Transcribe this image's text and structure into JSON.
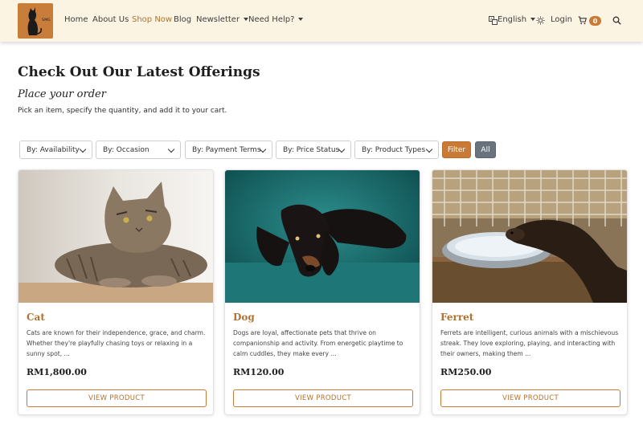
{
  "brand": {
    "logo_text": "SMG"
  },
  "nav": {
    "home": "Home",
    "about": "About Us",
    "shop": "Shop Now",
    "blog": "Blog",
    "newsletter": "Newsletter",
    "help": "Need Help?",
    "language": "English",
    "login": "Login",
    "cart_count": "0"
  },
  "icons": {
    "translate": "translate-icon",
    "theme": "sun-icon",
    "cart": "cart-icon",
    "search": "search-icon"
  },
  "colors": {
    "accent": "#c97b35",
    "nav_bg": "#fcf4e3",
    "secondary": "#6a737d"
  },
  "page": {
    "title": "Check Out Our Latest Offerings",
    "subtitle": "Place your order",
    "intro": "Pick an item, specify the quantity, and add it to your cart."
  },
  "filters": {
    "availability": "By: Availability",
    "occasion": "By: Occasion",
    "payment": "By: Payment Terms",
    "price_status": "By: Price Status",
    "product_types": "By: Product Types",
    "filter_btn": "Filter",
    "all_btn": "All"
  },
  "products": [
    {
      "name": "Cat",
      "description": "Cats are known for their independence, grace, and charm. Whether they're playfully chasing toys or relaxing in a sunny spot, ...",
      "price": "RM1,800.00",
      "button": "VIEW PRODUCT"
    },
    {
      "name": "Dog",
      "description": "Dogs are loyal, affectionate pets that thrive on companionship and activity. From energetic playtime to calm cuddles, they make every ...",
      "price": "RM120.00",
      "button": "VIEW PRODUCT"
    },
    {
      "name": "Ferret",
      "description": "Ferrets are intelligent, curious animals with a mischievous streak. They love exploring, playing, and interacting with their owners, making them ...",
      "price": "RM250.00",
      "button": "VIEW PRODUCT"
    }
  ]
}
